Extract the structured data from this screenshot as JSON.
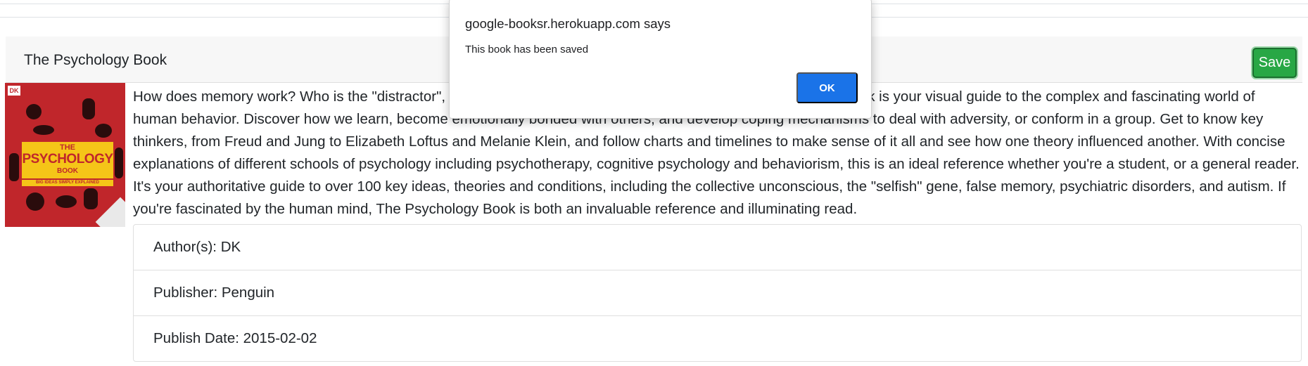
{
  "book": {
    "title": "The Psychology Book",
    "save_label": "Save",
    "cover": {
      "publisher_logo": "DK",
      "title_small": "THE",
      "title_big": "PSYCHOLOGY",
      "title_book": "BOOK",
      "tagline": "BIG IDEAS SIMPLY EXPLAINED"
    },
    "description": "How does memory work? Who is the \"distractor\", and are you one? How does the mind work? The Psychology Book is your visual guide to the complex and fascinating world of human behavior. Discover how we learn, become emotionally bonded with others, and develop coping mechanisms to deal with adversity, or conform in a group. Get to know key thinkers, from Freud and Jung to Elizabeth Loftus and Melanie Klein, and follow charts and timelines to make sense of it all and see how one theory influenced another. With concise explanations of different schools of psychology including psychotherapy, cognitive psychology and behaviorism, this is an ideal reference whether you're a student, or a general reader. It's your authoritative guide to over 100 key ideas, theories and conditions, including the collective unconscious, the \"selfish\" gene, false memory, psychiatric disorders, and autism. If you're fascinated by the human mind, The Psychology Book is both an invaluable reference and illuminating read.",
    "details": {
      "authors": "Author(s): DK",
      "publisher": "Publisher: Penguin",
      "publish_date": "Publish Date: 2015-02-02"
    }
  },
  "dialog": {
    "origin": "google-booksr.herokuapp.com says",
    "message": "This book has been saved",
    "ok_label": "OK"
  },
  "colors": {
    "save_button": "#28a745",
    "ok_button": "#1a73e8",
    "cover_red": "#c0262b",
    "cover_yellow": "#f5c518"
  }
}
